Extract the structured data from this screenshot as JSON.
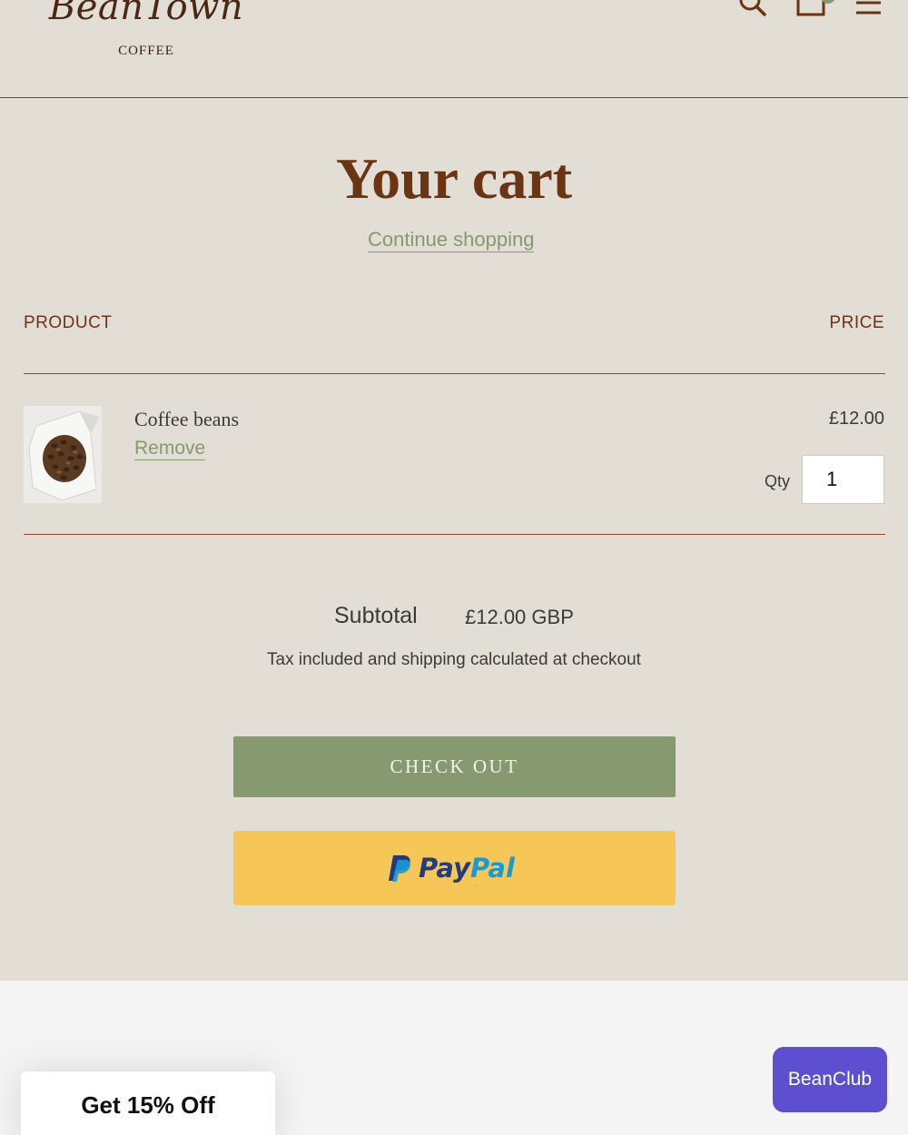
{
  "header": {
    "logo_script": "BeanTown",
    "logo_sub": "COFFEE",
    "icons": [
      "search-icon",
      "bag-icon",
      "menu-icon"
    ],
    "accent": "#7a3f1c"
  },
  "cart": {
    "title": "Your cart",
    "continue_label": "Continue shopping",
    "columns": {
      "product": "PRODUCT",
      "price": "PRICE"
    },
    "items": [
      {
        "name": "Coffee beans",
        "remove_label": "Remove",
        "price": "£12.00",
        "qty_label": "Qty",
        "qty": "1"
      }
    ],
    "subtotal_label": "Subtotal",
    "subtotal_value": "£12.00 GBP",
    "tax_note": "Tax included and shipping calculated at checkout",
    "checkout_label": "CHECK OUT",
    "paypal": {
      "pay": "Pay",
      "pal": "Pal"
    }
  },
  "footer": {
    "promo_label": "Get 15% Off",
    "club_label": "BeanClub"
  },
  "colors": {
    "background": "#e2ddd5",
    "brand_brown": "#6b3413",
    "green": "#86996f",
    "paypal_yellow": "#f6c657",
    "club_purple": "#5e4fd1"
  }
}
